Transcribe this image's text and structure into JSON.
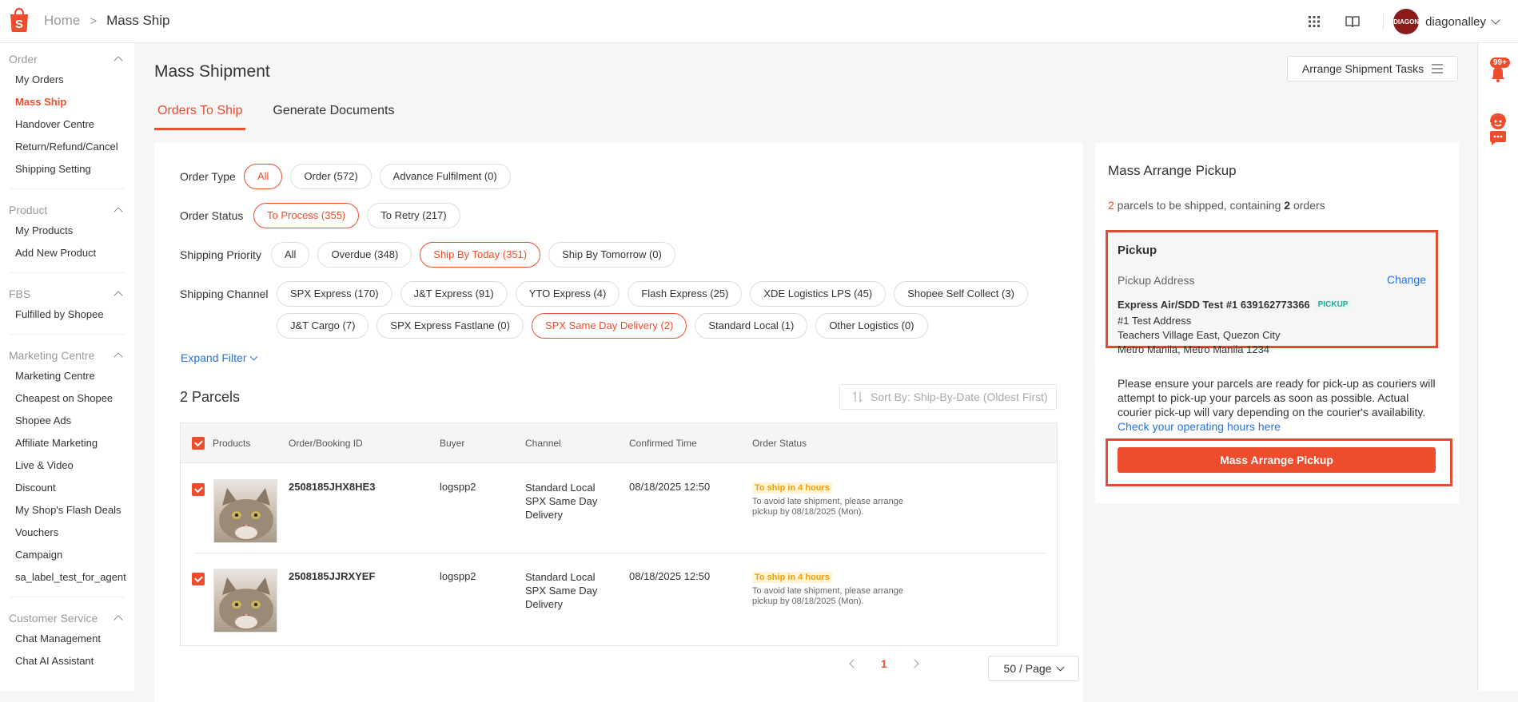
{
  "header": {
    "breadcrumb_home": "Home",
    "breadcrumb_current": "Mass Ship",
    "username": "diagonalley",
    "avatar_text": "DIAGON"
  },
  "sidebar": {
    "sections": [
      {
        "title": "Order",
        "items": [
          "My Orders",
          "Mass Ship",
          "Handover Centre",
          "Return/Refund/Cancel",
          "Shipping Setting"
        ]
      },
      {
        "title": "Product",
        "items": [
          "My Products",
          "Add New Product"
        ]
      },
      {
        "title": "FBS",
        "items": [
          "Fulfilled by Shopee"
        ]
      },
      {
        "title": "Marketing Centre",
        "items": [
          "Marketing Centre",
          "Cheapest on Shopee",
          "Shopee Ads",
          "Affiliate Marketing",
          "Live & Video",
          "Discount",
          "My Shop's Flash Deals",
          "Vouchers",
          "Campaign",
          "sa_label_test_for_agent"
        ]
      },
      {
        "title": "Customer Service",
        "items": [
          "Chat Management",
          "Chat AI Assistant"
        ]
      }
    ]
  },
  "page": {
    "title": "Mass Shipment",
    "tasks_button": "Arrange Shipment Tasks",
    "tabs": [
      "Orders To Ship",
      "Generate Documents"
    ]
  },
  "filters": {
    "order_type_label": "Order Type",
    "order_type": [
      "All",
      "Order (572)",
      "Advance Fulfilment (0)"
    ],
    "order_status_label": "Order Status",
    "order_status": [
      "To Process (355)",
      "To Retry (217)"
    ],
    "shipping_priority_label": "Shipping Priority",
    "shipping_priority": [
      "All",
      "Overdue (348)",
      "Ship By Today (351)",
      "Ship By Tomorrow (0)"
    ],
    "shipping_channel_label": "Shipping Channel",
    "shipping_channel": [
      "SPX Express (170)",
      "J&T Express (91)",
      "YTO Express (4)",
      "Flash Express (25)",
      "XDE Logistics LPS (45)",
      "Shopee Self Collect (3)",
      "J&T Cargo (7)",
      "SPX Express Fastlane (0)",
      "SPX Same Day Delivery (2)",
      "Standard Local (1)",
      "Other Logistics (0)"
    ],
    "expand": "Expand Filter"
  },
  "parcels": {
    "title": "2 Parcels",
    "sort": "Sort By: Ship-By-Date (Oldest First)",
    "columns": [
      "Products",
      "Order/Booking ID",
      "Buyer",
      "Channel",
      "Confirmed Time",
      "Order Status"
    ],
    "rows": [
      {
        "order_id": "2508185JHX8HE3",
        "buyer": "logspp2",
        "channel_1": "Standard Local",
        "channel_2": "SPX Same Day",
        "channel_3": "Delivery",
        "confirmed": "08/18/2025 12:50",
        "status": "To ship in 4 hours",
        "note_1": "To avoid late shipment, please arrange",
        "note_2": "pickup by 08/18/2025 (Mon)."
      },
      {
        "order_id": "2508185JJRXYEF",
        "buyer": "logspp2",
        "channel_1": "Standard Local",
        "channel_2": "SPX Same Day",
        "channel_3": "Delivery",
        "confirmed": "08/18/2025 12:50",
        "status": "To ship in 4 hours",
        "note_1": "To avoid late shipment, please arrange",
        "note_2": "pickup by 08/18/2025 (Mon)."
      }
    ],
    "page_number": "1",
    "per_page": "50 / Page"
  },
  "pickup_panel": {
    "title": "Mass Arrange Pickup",
    "summary_count": "2",
    "summary_mid": " parcels to be shipped, containing ",
    "summary_orders": "2",
    "summary_end": " orders",
    "pickup_title": "Pickup",
    "address_label": "Pickup Address",
    "change": "Change",
    "name": "Express Air/SDD Test #1 639162773366",
    "tag": "PICKUP",
    "addr_1": "#1 Test Address",
    "addr_2": "Teachers Village East, Quezon City",
    "addr_3": "Metro Manila, Metro Manila 1234",
    "notice": "Please ensure your parcels are ready for pick-up as couriers will attempt to pick-up your parcels as soon as possible. Actual courier pick-up will vary depending on the courier's availability.",
    "notice_link": "Check your operating hours here",
    "button": "Mass Arrange Pickup"
  },
  "rail": {
    "badge": "99+"
  },
  "colors": {
    "accent": "#ee4d2d",
    "link": "#2673dd",
    "highlight": "#e24a33"
  },
  "icons": [
    "shopee-logo-icon",
    "apps-grid-icon",
    "book-icon",
    "chevron-down-icon",
    "bell-icon",
    "support-agent-icon",
    "chat-icon",
    "sort-icon",
    "menu-icon"
  ]
}
